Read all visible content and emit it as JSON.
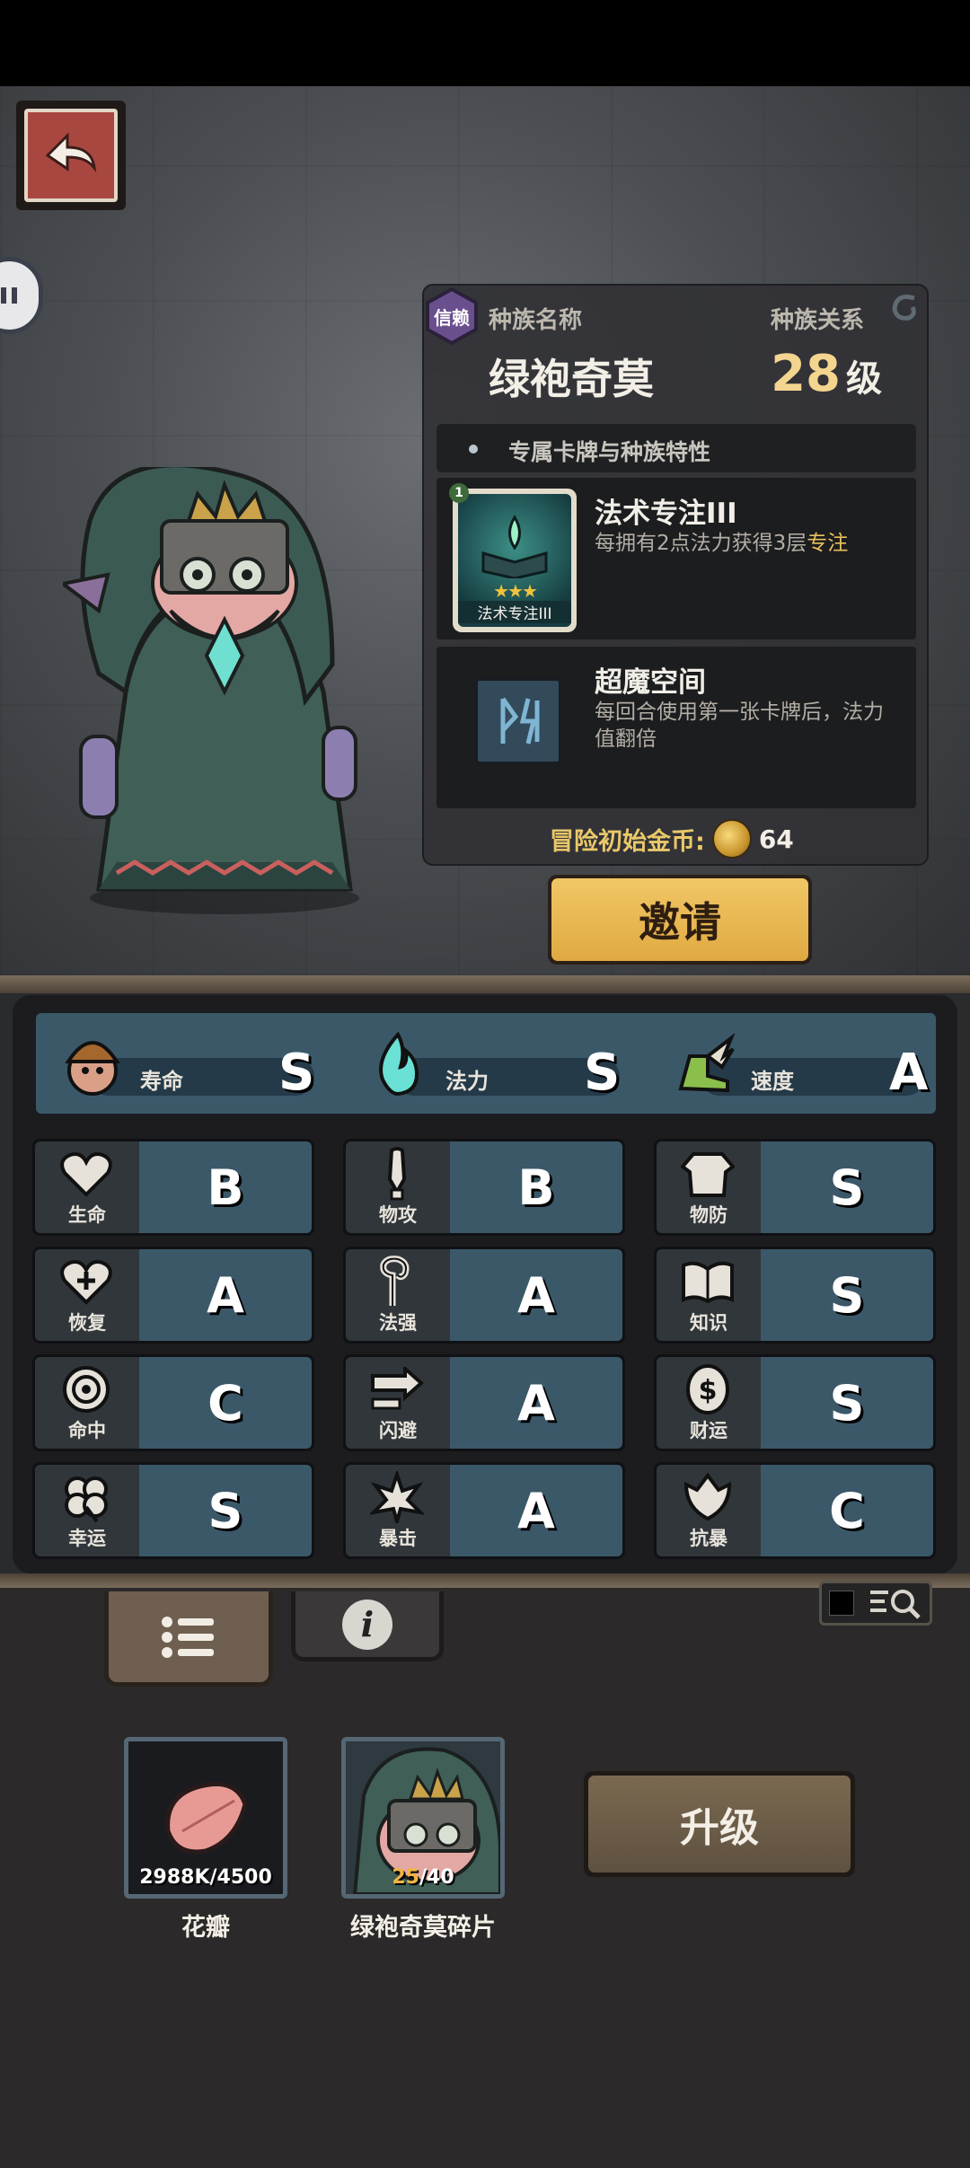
{
  "header": {
    "back_icon": "back-arrow-icon",
    "side_icon": "pause-icon"
  },
  "race_panel": {
    "trust_badge": "信赖",
    "race_name_label": "种族名称",
    "race_relation_label": "种族关系",
    "race_name": "绿袍奇莫",
    "level": "28",
    "level_unit": "级",
    "section_title": "专属卡牌与种族特性",
    "cards": [
      {
        "title": "法术专注III",
        "desc_prefix": "每拥有2点法力获得3层",
        "desc_highlight": "专注",
        "card_caption": "法术专注III",
        "card_badge": "1",
        "stars": "★★★"
      },
      {
        "title": "超魔空间",
        "desc": "每回合使用第一张卡牌后，法力值翻倍"
      }
    ],
    "gold_label": "冒险初始金币:",
    "gold_value": "64"
  },
  "invite_button": "邀请",
  "big_stats": [
    {
      "label": "寿命",
      "grade": "S",
      "icon": "helmet-face-icon"
    },
    {
      "label": "法力",
      "grade": "S",
      "icon": "blue-flame-icon"
    },
    {
      "label": "速度",
      "grade": "A",
      "icon": "winged-boot-icon"
    }
  ],
  "stats": [
    {
      "label": "生命",
      "grade": "B",
      "icon": "heart-icon"
    },
    {
      "label": "物攻",
      "grade": "B",
      "icon": "sword-icon"
    },
    {
      "label": "物防",
      "grade": "S",
      "icon": "armor-icon"
    },
    {
      "label": "恢复",
      "grade": "A",
      "icon": "heart-plus-icon"
    },
    {
      "label": "法强",
      "grade": "A",
      "icon": "staff-icon"
    },
    {
      "label": "知识",
      "grade": "S",
      "icon": "book-icon"
    },
    {
      "label": "命中",
      "grade": "C",
      "icon": "target-icon"
    },
    {
      "label": "闪避",
      "grade": "A",
      "icon": "dash-arrow-icon"
    },
    {
      "label": "财运",
      "grade": "S",
      "icon": "coin-icon"
    },
    {
      "label": "幸运",
      "grade": "S",
      "icon": "clover-icon"
    },
    {
      "label": "暴击",
      "grade": "A",
      "icon": "crit-icon"
    },
    {
      "label": "抗暴",
      "grade": "C",
      "icon": "shield-flower-icon"
    }
  ],
  "items": [
    {
      "name": "花瓣",
      "count_current": "2988K",
      "count_total": "/4500"
    },
    {
      "name": "绿袍奇莫碎片",
      "count_current": "25",
      "count_total": "/40"
    }
  ],
  "upgrade_button": "升级",
  "colors": {
    "accent_gold": "#e0a941",
    "stat_blue": "#3b5869",
    "background": "#2b2929"
  }
}
